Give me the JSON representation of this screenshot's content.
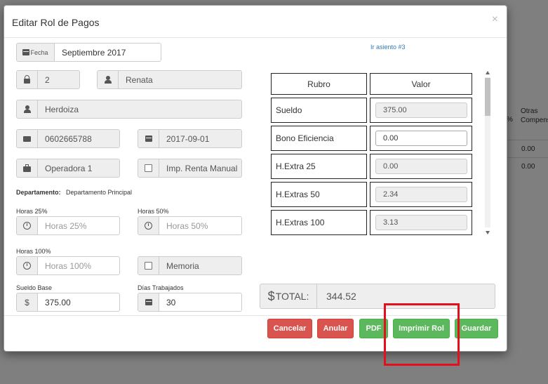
{
  "background": {
    "headers": [
      "%",
      "Otras",
      "Compens"
    ],
    "cells": [
      "0.00",
      "0.00"
    ]
  },
  "modal": {
    "title": "Editar Rol de Pagos",
    "close": "×",
    "link_asiento": "Ir asiento #3"
  },
  "form": {
    "fecha_label": "Fecha",
    "fecha_value": "Septiembre 2017",
    "id_value": "2",
    "nombre": "Renata",
    "apellido": "Herdoiza",
    "cedula": "0602665788",
    "fecha_ingreso": "2017-09-01",
    "cargo": "Operadora 1",
    "imp_renta": "Imp. Renta Manual",
    "departamento_label": "Departamento:",
    "departamento_value": "Departamento Principal",
    "horas25_label": "Horas 25%",
    "horas25_placeholder": "Horas 25%",
    "horas50_label": "Horas 50%",
    "horas50_placeholder": "Horas 50%",
    "horas100_label": "Horas 100%",
    "horas100_placeholder": "Horas 100%",
    "memoria": "Memoria",
    "sueldo_base_label": "Sueldo Base",
    "sueldo_base_value": "375.00",
    "sueldo_symbol": "$",
    "dias_label": "Días Trabajados",
    "dias_value": "30"
  },
  "table": {
    "headers": [
      "Rubro",
      "Valor"
    ],
    "rows": [
      {
        "rubro": "Sueldo",
        "valor": "375.00"
      },
      {
        "rubro": "Bono Eficiencia",
        "valor": "0.00"
      },
      {
        "rubro": "H.Extra 25",
        "valor": "0.00"
      },
      {
        "rubro": "H.Extras 50",
        "valor": "2.34"
      },
      {
        "rubro": "H.Extras 100",
        "valor": "3.13"
      }
    ]
  },
  "total": {
    "symbol": "$",
    "label": "TOTAL:",
    "value": "344.52"
  },
  "buttons": {
    "cancelar": "Cancelar",
    "anular": "Anular",
    "pdf": "PDF",
    "imprimir": "Imprimir Rol",
    "guardar": "Guardar"
  },
  "colors": {
    "danger": "#d9534f",
    "success": "#5cb85c",
    "highlight": "#e3101b",
    "link": "#337ab7"
  }
}
